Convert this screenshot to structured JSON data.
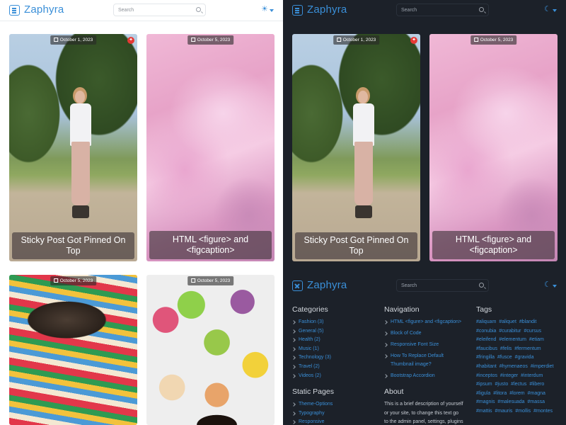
{
  "brand": "Zaphyra",
  "search": {
    "placeholder": "Search"
  },
  "posts": [
    {
      "date": "October 1, 2023",
      "title": "Sticky Post Got Pinned On Top",
      "pinned": true
    },
    {
      "date": "October 5, 2023",
      "title": "HTML <figure> and <figcaption>"
    },
    {
      "date": "October 5, 2023",
      "title": ""
    },
    {
      "date": "October 5, 2023",
      "title": ""
    }
  ],
  "sidebar": {
    "categories": {
      "heading": "Categories",
      "items": [
        "Fashion (3)",
        "General (5)",
        "Health (2)",
        "Music (1)",
        "Technology (3)",
        "Travel (2)",
        "Videos (2)"
      ]
    },
    "navigation": {
      "heading": "Navigation",
      "items": [
        "HTML <figure> and <figcaption>",
        "Block of Code",
        "Responsive Font Size",
        "How To Replace Default Thumbnail image?",
        "Bootstrap Accordion"
      ]
    },
    "tags": {
      "heading": "Tags",
      "items": [
        "#aliquam",
        "#aliquet",
        "#blandit",
        "#conubia",
        "#curabitur",
        "#cursus",
        "#eleifend",
        "#elementum",
        "#etiam",
        "#faucibus",
        "#felis",
        "#fermentum",
        "#fringilla",
        "#fusce",
        "#gravida",
        "#habitant",
        "#hymenaeos",
        "#imperdiet",
        "#inceptos",
        "#integer",
        "#interdum",
        "#ipsum",
        "#justo",
        "#lectus",
        "#libero",
        "#ligula",
        "#litora",
        "#lorem",
        "#magna",
        "#magnis",
        "#malesuada",
        "#massa",
        "#mattis",
        "#mauris",
        "#mollis",
        "#montes"
      ]
    },
    "static_pages": {
      "heading": "Static Pages",
      "items": [
        "Theme-Options",
        "Typography",
        "Responsive"
      ]
    },
    "about": {
      "heading": "About",
      "text": "This is a brief description of yourself or your site, to change this text go to the admin panel, settings, plugins"
    }
  },
  "colors": {
    "accent": "#3a8fd8",
    "dark_bg": "#1c2129"
  }
}
